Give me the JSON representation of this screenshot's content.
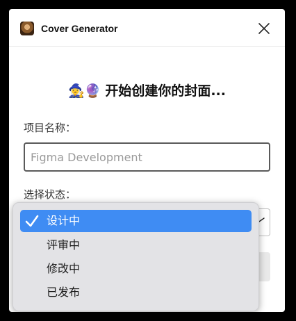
{
  "window": {
    "title": "Cover Generator"
  },
  "main": {
    "heading_emoji": "🧙‍♀️🔮",
    "heading": "开始创建你的封面...",
    "project_label": "项目名称：",
    "project_placeholder": "Figma Development",
    "project_value": "",
    "status_label": "选择状态："
  },
  "status_dropdown": {
    "selected": "设计中",
    "options": [
      {
        "label": "设计中",
        "selected": true
      },
      {
        "label": "评审中",
        "selected": false
      },
      {
        "label": "修改中",
        "selected": false
      },
      {
        "label": "已发布",
        "selected": false
      }
    ]
  },
  "colors": {
    "accent": "#3f8cf3",
    "menu_bg": "#e3e3e6"
  },
  "icons": {
    "close": "close-icon",
    "check": "checkmark-icon",
    "chevron": "chevron-down-icon",
    "app": "app-icon"
  }
}
